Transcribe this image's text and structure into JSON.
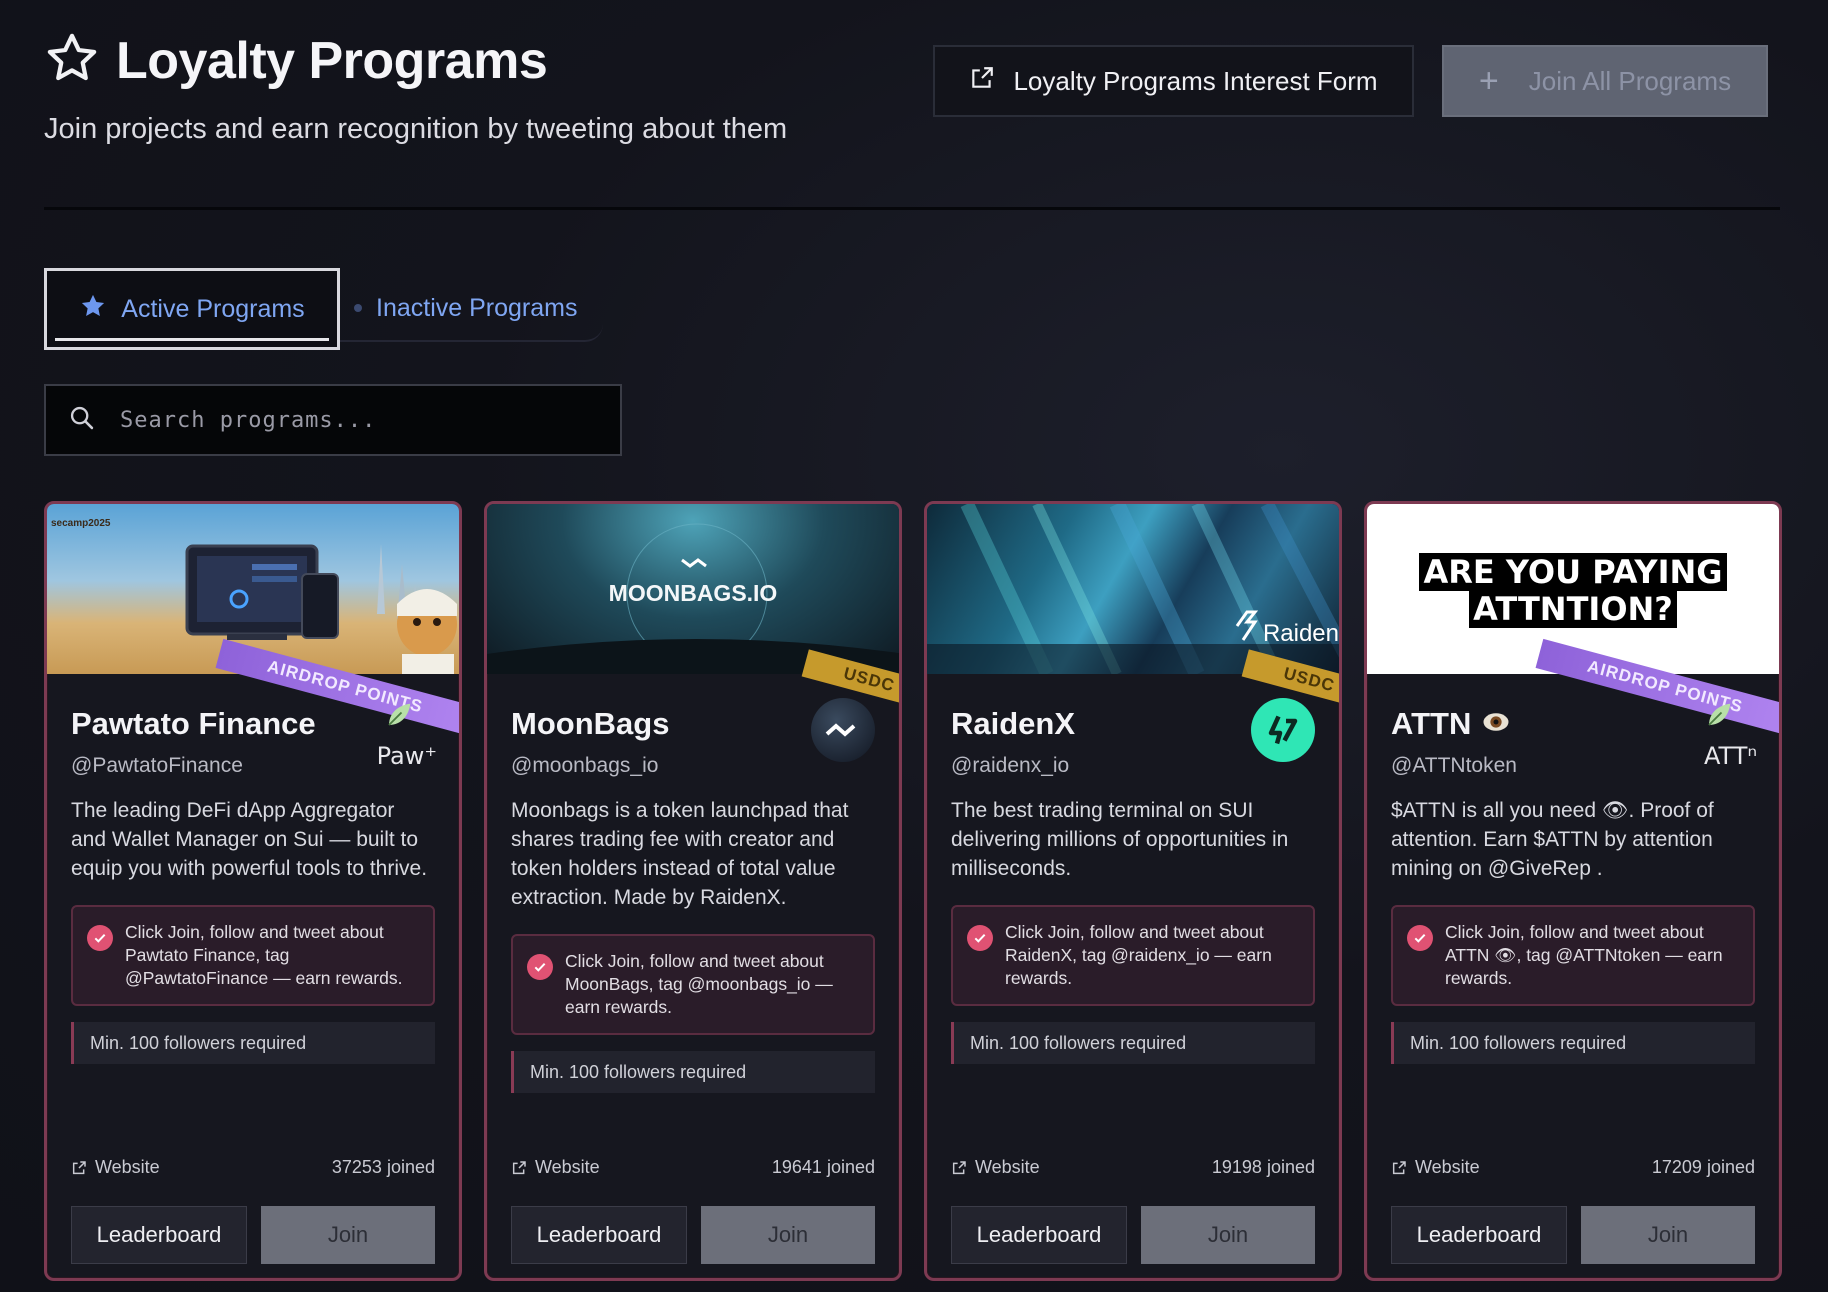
{
  "header": {
    "title": "Loyalty Programs",
    "subtitle": "Join projects and earn recognition by tweeting about them",
    "interest_form_label": "Loyalty Programs Interest Form",
    "join_all_label": "Join All Programs"
  },
  "tabs": {
    "active_label": "Active Programs",
    "inactive_label": "Inactive Programs"
  },
  "search": {
    "placeholder": "Search programs..."
  },
  "cards": [
    {
      "name": "Pawtato Finance",
      "handle": "@PawtatoFinance",
      "description": "The leading DeFi dApp Aggregator and Wallet Manager on Sui — built to equip you with powerful tools to thrive.",
      "note": "Click Join, follow and tweet about Pawtato Finance, tag @PawtatoFinance — earn rewards.",
      "requirement": "Min. 100 followers required",
      "website_label": "Website",
      "joined": "37253 joined",
      "leaderboard_label": "Leaderboard",
      "join_label": "Join",
      "ribbon": "AIRDROP POINTS",
      "logo_text": "Paw⁺",
      "banner_caption": "secamp2025"
    },
    {
      "name": "MoonBags",
      "handle": "@moonbags_io",
      "description": "Moonbags is a token launchpad that shares trading fee with creator and token holders instead of total value extraction. Made by RaidenX.",
      "note": "Click Join, follow and tweet about MoonBags, tag @moonbags_io — earn rewards.",
      "requirement": "Min. 100 followers required",
      "website_label": "Website",
      "joined": "19641 joined",
      "leaderboard_label": "Leaderboard",
      "join_label": "Join",
      "ribbon": "USDC",
      "banner_caption": "MOONBAGS.IO"
    },
    {
      "name": "RaidenX",
      "handle": "@raidenx_io",
      "description": "The best trading terminal on SUI delivering millions of opportunities in milliseconds.",
      "note": "Click Join, follow and tweet about RaidenX, tag @raidenx_io — earn rewards.",
      "requirement": "Min. 100 followers required",
      "website_label": "Website",
      "joined": "19198 joined",
      "leaderboard_label": "Leaderboard",
      "join_label": "Join",
      "ribbon": "USDC",
      "banner_caption": "Raiden"
    },
    {
      "name": "ATTN",
      "handle": "@ATTNtoken",
      "description": "$ATTN is all you need 👁. Proof of attention. Earn $ATTN by attention mining on @GiveRep .",
      "note": "Click Join, follow and tweet about ATTN 👁, tag @ATTNtoken — earn rewards.",
      "requirement": "Min. 100 followers required",
      "website_label": "Website",
      "joined": "17209 joined",
      "leaderboard_label": "Leaderboard",
      "join_label": "Join",
      "ribbon": "AIRDROP POINTS",
      "logo_text": "ATTⁿ",
      "banner_caption_line1": "ARE YOU PAYING",
      "banner_caption_line2": "ATTNTION?"
    }
  ],
  "colors": {
    "accent_blue": "#7fa6f2",
    "card_border": "#7d3a52",
    "check_pink": "#e05273",
    "airdrop_purple": "#a67ae8",
    "usdc_gold": "#c69a2c",
    "raiden_green": "#2fe6b5"
  },
  "icons": [
    "star-outline-icon",
    "external-link-icon",
    "plus-icon",
    "star-filled-icon",
    "search-icon",
    "check-circle-icon",
    "leaf-icon",
    "eye-icon"
  ]
}
